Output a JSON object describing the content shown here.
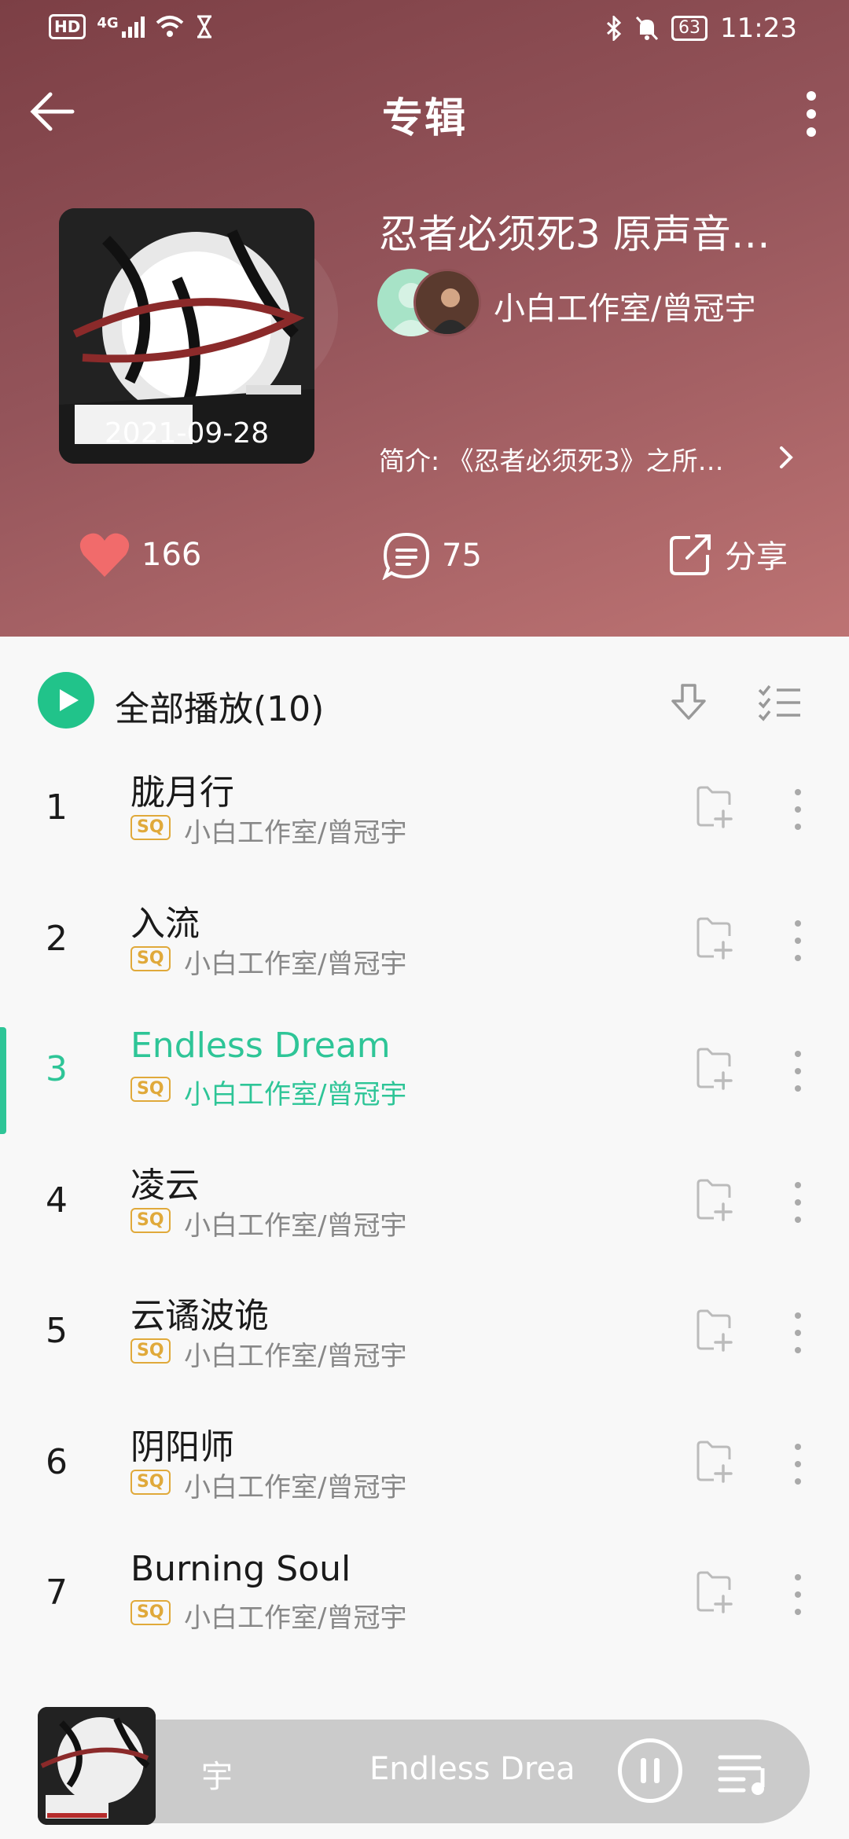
{
  "status_bar": {
    "network": "4G",
    "hd": "HD",
    "battery": "63",
    "time": "11:23"
  },
  "topbar": {
    "title": "专辑"
  },
  "album": {
    "title": "忍者必须死3 原声音…",
    "date": "2021-09-28",
    "artist": "小白工作室/曾冠宇",
    "intro": "简介: 《忍者必须死3》之所…"
  },
  "stats": {
    "likes": "166",
    "comments": "75",
    "share_label": "分享"
  },
  "playall": {
    "label": "全部播放(10)"
  },
  "tracks": [
    {
      "num": "1",
      "name": "胧月行",
      "quality": "SQ",
      "artist": "小白工作室/曾冠宇"
    },
    {
      "num": "2",
      "name": "入流",
      "quality": "SQ",
      "artist": "小白工作室/曾冠宇"
    },
    {
      "num": "3",
      "name": "Endless Dream",
      "quality": "SQ",
      "artist": "小白工作室/曾冠宇"
    },
    {
      "num": "4",
      "name": "凌云",
      "quality": "SQ",
      "artist": "小白工作室/曾冠宇"
    },
    {
      "num": "5",
      "name": "云谲波诡",
      "quality": "SQ",
      "artist": "小白工作室/曾冠宇"
    },
    {
      "num": "6",
      "name": "阴阳师",
      "quality": "SQ",
      "artist": "小白工作室/曾冠宇"
    },
    {
      "num": "7",
      "name": "Burning Soul",
      "quality": "SQ",
      "artist": "小白工作室/曾冠宇"
    }
  ],
  "player": {
    "text_left": "宇",
    "text_right": "Endless Dream"
  },
  "colors": {
    "accent": "#2ec597",
    "header_top": "#7c3f45",
    "header_bottom": "#bd7373",
    "sq": "#e0a93a"
  }
}
